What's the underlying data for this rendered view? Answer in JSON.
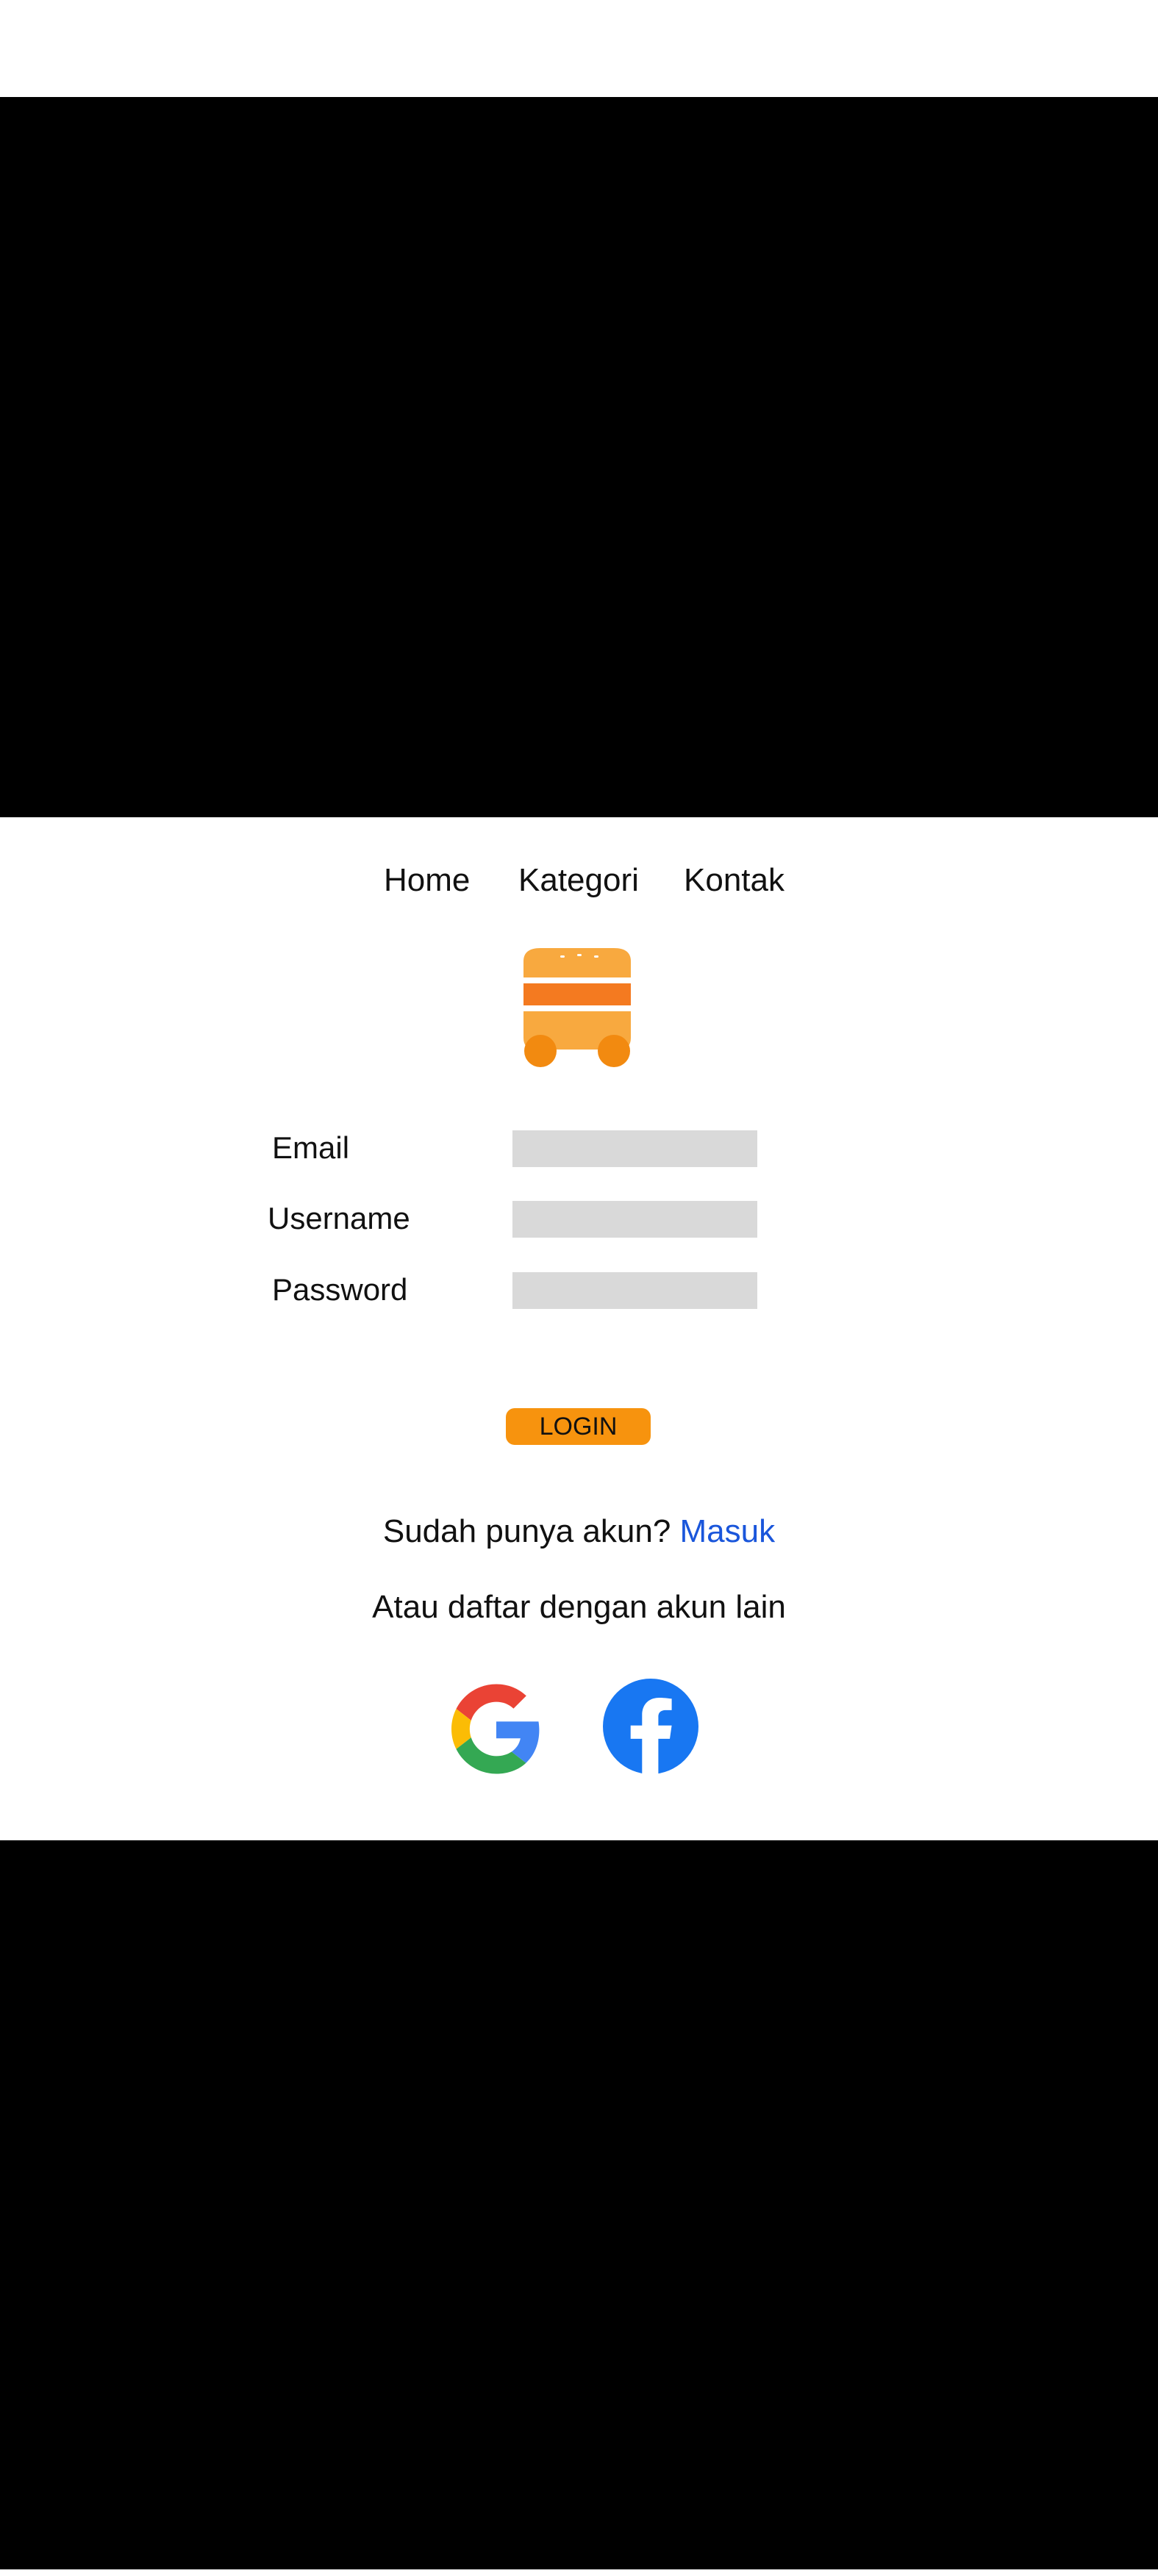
{
  "nav": {
    "items": [
      {
        "label": "Home"
      },
      {
        "label": "Kategori"
      },
      {
        "label": "Kontak"
      }
    ]
  },
  "logo": {
    "icon": "food-truck-burger-icon"
  },
  "form": {
    "email_label": "Email",
    "email_value": "",
    "username_label": "Username",
    "username_value": "",
    "password_label": "Password",
    "password_value": ""
  },
  "login_button": {
    "label": "LOGIN"
  },
  "account": {
    "prompt": "Sudah punya akun? ",
    "link_label": "Masuk"
  },
  "alternate": {
    "label": "Atau daftar dengan akun lain"
  },
  "social": [
    {
      "icon": "google-icon"
    },
    {
      "icon": "facebook-icon"
    }
  ],
  "colors": {
    "accent": "#f7930e",
    "link": "#1a56db",
    "input_bg": "#d9d9d9"
  }
}
